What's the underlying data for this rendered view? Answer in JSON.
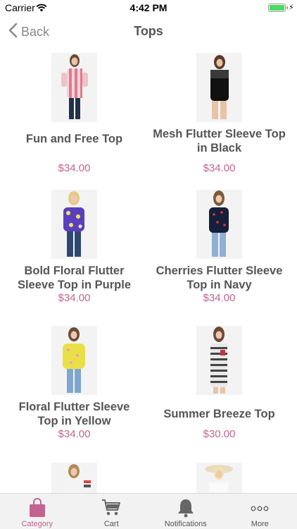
{
  "status_bar": {
    "carrier": "Carrier",
    "time": "4:42 PM",
    "battery_level": 1.0
  },
  "nav": {
    "back_label": "Back",
    "title": "Tops"
  },
  "products": [
    {
      "name": "Fun and Free Top",
      "price": "$34.00",
      "image": "model-striped-off-shoulder-top-photo"
    },
    {
      "name": "Mesh Flutter Sleeve Top in Black",
      "price": "$34.00",
      "image": "model-black-mesh-top-photo"
    },
    {
      "name": "Bold Floral Flutter Sleeve Top in Purple",
      "price": "$34.00",
      "image": "model-purple-floral-top-photo"
    },
    {
      "name": "Cherries Flutter Sleeve Top in Navy",
      "price": "$34.00",
      "image": "model-navy-cherries-top-photo"
    },
    {
      "name": "Floral Flutter Sleeve Top in Yellow",
      "price": "$34.00",
      "image": "model-yellow-floral-top-photo"
    },
    {
      "name": "Summer Breeze Top",
      "price": "$30.00",
      "image": "model-striped-tank-top-photo"
    },
    {
      "name": "",
      "price": "",
      "image": "model-striped-sleeve-top-photo"
    },
    {
      "name": "",
      "price": "",
      "image": "model-white-top-sunhat-photo"
    }
  ],
  "tabs": [
    {
      "label": "Category",
      "icon": "shopping-bag-icon",
      "active": true
    },
    {
      "label": "Cart",
      "icon": "cart-icon",
      "active": false
    },
    {
      "label": "Notifications",
      "icon": "bell-icon",
      "active": false
    },
    {
      "label": "More",
      "icon": "more-dots-icon",
      "active": false
    }
  ],
  "colors": {
    "accent": "#c2648f",
    "text": "#555555",
    "tab_bar": "#f2f2f2"
  }
}
